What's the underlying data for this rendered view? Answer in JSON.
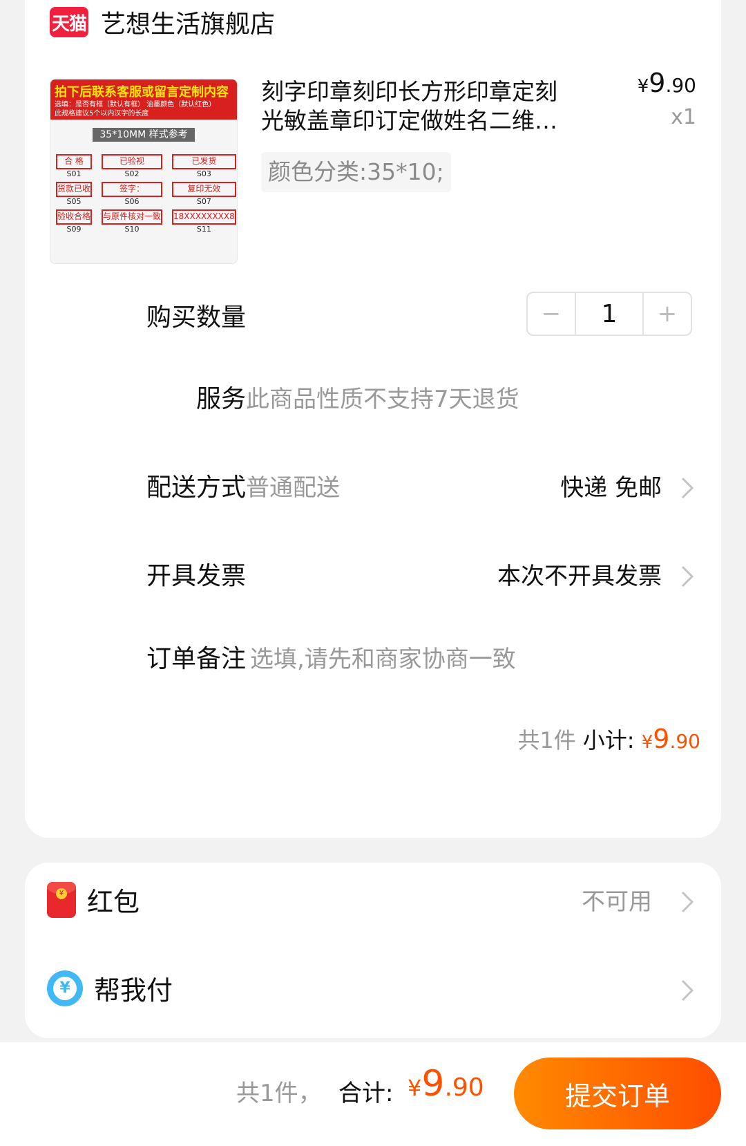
{
  "shop": {
    "badge": "天猫",
    "name": "艺想生活旗舰店"
  },
  "product": {
    "image": {
      "title": "拍下后联系客服或留言定制内容",
      "subtitle1": "选填：是否有框（默认有框） 油墨颜色（默认红色）",
      "subtitle2": "此规格建议5个以内汉字的长度",
      "size_label": "35*10MM 样式参考",
      "stamps": [
        {
          "text": "合 格",
          "code": "S01"
        },
        {
          "text": "已验视",
          "code": "S02"
        },
        {
          "text": "已发货",
          "code": "S03"
        },
        {
          "text": "货款已收",
          "code": "S05"
        },
        {
          "text": "签字：",
          "code": "S06"
        },
        {
          "text": "复印无效",
          "code": "S07"
        },
        {
          "text": "验收合格",
          "code": "S09"
        },
        {
          "text": "与原件核对一致",
          "code": "S10"
        },
        {
          "text": "18XXXXXXXX8",
          "code": "S11"
        }
      ]
    },
    "title_line1": "刻字印章刻印长方形印章定刻",
    "title_line2": "光敏盖章印订定做姓名二维…",
    "sku": "颜色分类:35*10;",
    "price": {
      "currency": "¥",
      "int": "9",
      "dec": ".90"
    },
    "qty": "x1"
  },
  "quantity": {
    "label": "购买数量",
    "value": "1",
    "minus": "−",
    "plus": "+"
  },
  "service": {
    "label": "服务",
    "value": "此商品性质不支持7天退货"
  },
  "delivery": {
    "label": "配送方式",
    "value": "普通配送",
    "right": "快递 免邮"
  },
  "invoice": {
    "label": "开具发票",
    "right": "本次不开具发票"
  },
  "remark": {
    "label": "订单备注",
    "placeholder": "选填,请先和商家协商一致"
  },
  "subtotal": {
    "count": "共1件",
    "label": "小计:",
    "currency": "¥",
    "int": "9",
    "dec": ".90"
  },
  "red_packet": {
    "label": "红包",
    "status": "不可用"
  },
  "help_pay": {
    "label": "帮我付"
  },
  "bottom": {
    "count": "共1件，",
    "total_label": "合计:",
    "currency": "¥",
    "int": "9",
    "dec": ".90",
    "submit": "提交订单"
  },
  "colors": {
    "accent": "#ff5000",
    "tmall_red": "#f0203e",
    "help_pay_blue": "#3fb8f5"
  }
}
